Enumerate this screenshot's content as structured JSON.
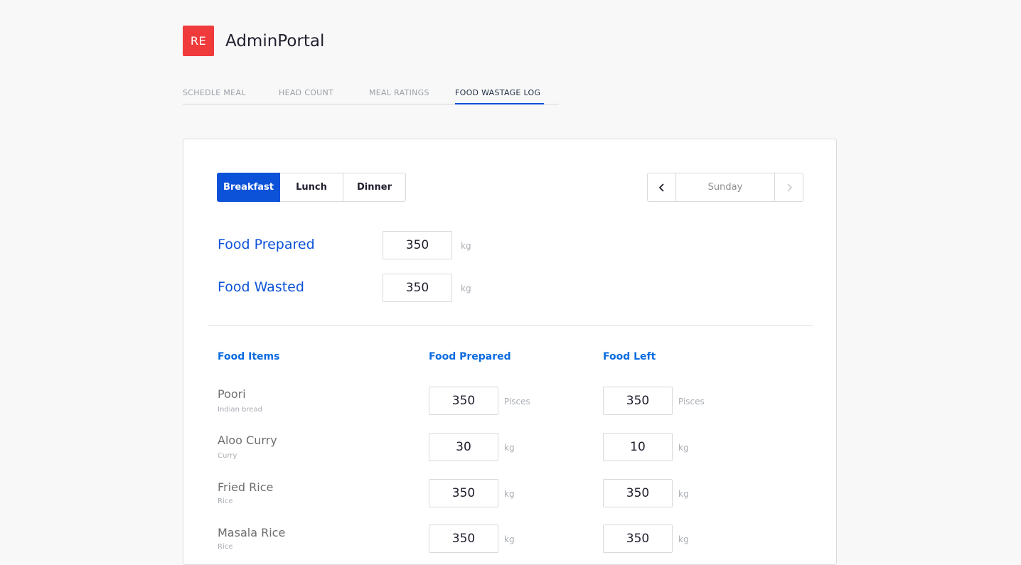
{
  "app": {
    "logo_text": "RE",
    "title": "AdminPortal",
    "logo_color": "#ef3b3b",
    "accent_color": "#0b52d8"
  },
  "tabs": [
    {
      "label": "SCHEDLE MEAL",
      "active": false
    },
    {
      "label": "HEAD COUNT",
      "active": false
    },
    {
      "label": "MEAL RATINGS",
      "active": false
    },
    {
      "label": "FOOD WASTAGE LOG",
      "active": true
    }
  ],
  "meal_types": [
    {
      "label": "Breakfast",
      "active": true
    },
    {
      "label": "Lunch",
      "active": false
    },
    {
      "label": "Dinner",
      "active": false
    }
  ],
  "day_picker": {
    "day": "Sunday",
    "prev_icon": "chevron-left-icon",
    "next_icon": "chevron-right-icon"
  },
  "summary": {
    "prepared_label": "Food Prepared",
    "prepared_value": "350",
    "prepared_unit": "kg",
    "wasted_label": "Food Wasted",
    "wasted_value": "350",
    "wasted_unit": "kg"
  },
  "table": {
    "headers": [
      "Food Items",
      "Food Prepared",
      "Food Left"
    ],
    "rows": [
      {
        "name": "Poori",
        "category": "Indian bread",
        "prepared": "350",
        "prepared_unit": "Pisces",
        "left": "350",
        "left_unit": "Pisces"
      },
      {
        "name": "Aloo Curry",
        "category": "Curry",
        "prepared": "30",
        "prepared_unit": "kg",
        "left": "10",
        "left_unit": "kg"
      },
      {
        "name": "Fried Rice",
        "category": "Rice",
        "prepared": "350",
        "prepared_unit": "kg",
        "left": "350",
        "left_unit": "kg"
      },
      {
        "name": "Masala Rice",
        "category": "Rice",
        "prepared": "350",
        "prepared_unit": "kg",
        "left": "350",
        "left_unit": "kg"
      }
    ]
  }
}
